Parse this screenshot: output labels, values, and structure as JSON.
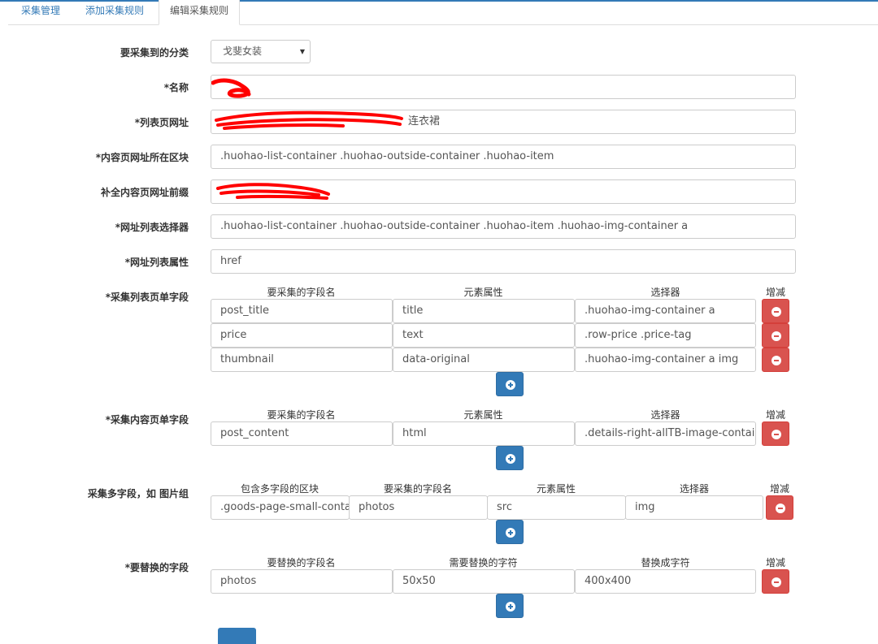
{
  "tabs": [
    "采集管理",
    "添加采集规则",
    "编辑采集规则"
  ],
  "form": {
    "category": {
      "label": "要采集到的分类",
      "value": "戈斐女装"
    },
    "name": {
      "label": "*名称",
      "value": ""
    },
    "list_url": {
      "label": "*列表页网址",
      "value": "连衣裙"
    },
    "content_block": {
      "label": "*内容页网址所在区块",
      "value": ".huohao-list-container .huohao-outside-container .huohao-item"
    },
    "url_prefix": {
      "label": "补全内容页网址前缀",
      "value": ""
    },
    "url_list_selector": {
      "label": "*网址列表选择器",
      "value": ".huohao-list-container .huohao-outside-container .huohao-item .huohao-img-container a"
    },
    "url_list_attr": {
      "label": "*网址列表属性",
      "value": "href"
    }
  },
  "list_fields": {
    "label": "*采集列表页单字段",
    "headers": [
      "要采集的字段名",
      "元素属性",
      "选择器",
      "增减"
    ],
    "rows": [
      [
        "post_title",
        "title",
        ".huohao-img-container a"
      ],
      [
        "price",
        "text",
        ".row-price .price-tag"
      ],
      [
        "thumbnail",
        "data-original",
        ".huohao-img-container a img"
      ]
    ]
  },
  "content_fields": {
    "label": "*采集内容页单字段",
    "headers": [
      "要采集的字段名",
      "元素属性",
      "选择器",
      "增减"
    ],
    "rows": [
      [
        "post_content",
        "html",
        ".details-right-allTB-image-container"
      ]
    ]
  },
  "multi_fields": {
    "label": "采集多字段，如 图片组",
    "headers": [
      "包含多字段的区块",
      "要采集的字段名",
      "元素属性",
      "选择器",
      "增减"
    ],
    "rows": [
      [
        ".goods-page-small-container",
        "photos",
        "src",
        "img"
      ]
    ]
  },
  "replace_fields": {
    "label": "*要替换的字段",
    "headers": [
      "要替换的字段名",
      "需要替换的字符",
      "替换成字符",
      "增减"
    ],
    "rows": [
      [
        "photos",
        "50x50",
        "400x400"
      ]
    ]
  },
  "colors": {
    "primary": "#337ab7",
    "danger": "#d9534f",
    "redaction": "#ff0000"
  },
  "icons": [
    "caret-down-icon",
    "minus-circle-icon",
    "plus-circle-icon"
  ]
}
